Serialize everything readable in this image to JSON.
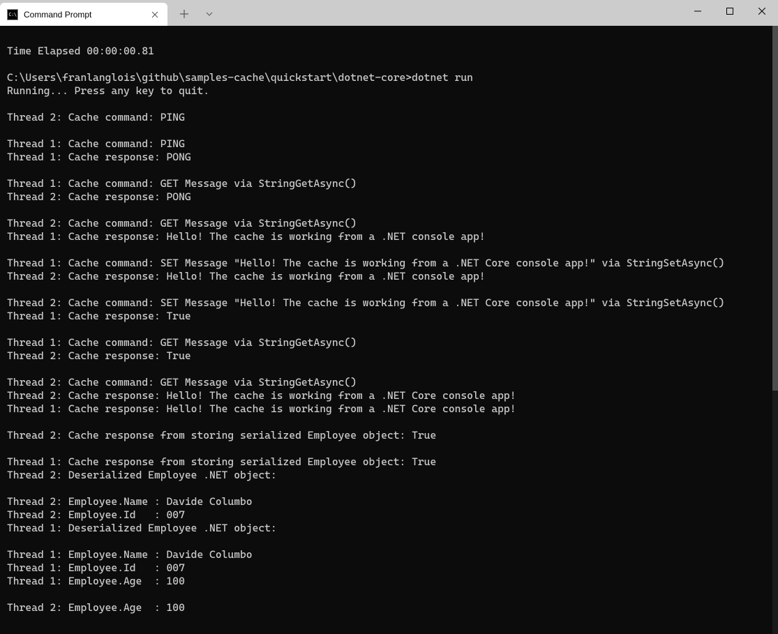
{
  "window": {
    "tab_title": "Command Prompt"
  },
  "terminal": {
    "lines": [
      "",
      "Time Elapsed 00:00:00.81",
      "",
      "C:\\Users\\franlanglois\\github\\samples-cache\\quickstart\\dotnet-core>dotnet run",
      "Running... Press any key to quit.",
      "",
      "Thread 2: Cache command: PING",
      "",
      "Thread 1: Cache command: PING",
      "Thread 1: Cache response: PONG",
      "",
      "Thread 1: Cache command: GET Message via StringGetAsync()",
      "Thread 2: Cache response: PONG",
      "",
      "Thread 2: Cache command: GET Message via StringGetAsync()",
      "Thread 1: Cache response: Hello! The cache is working from a .NET console app!",
      "",
      "Thread 1: Cache command: SET Message \"Hello! The cache is working from a .NET Core console app!\" via StringSetAsync()",
      "Thread 2: Cache response: Hello! The cache is working from a .NET console app!",
      "",
      "Thread 2: Cache command: SET Message \"Hello! The cache is working from a .NET Core console app!\" via StringSetAsync()",
      "Thread 1: Cache response: True",
      "",
      "Thread 1: Cache command: GET Message via StringGetAsync()",
      "Thread 2: Cache response: True",
      "",
      "Thread 2: Cache command: GET Message via StringGetAsync()",
      "Thread 2: Cache response: Hello! The cache is working from a .NET Core console app!",
      "Thread 1: Cache response: Hello! The cache is working from a .NET Core console app!",
      "",
      "Thread 2: Cache response from storing serialized Employee object: True",
      "",
      "Thread 1: Cache response from storing serialized Employee object: True",
      "Thread 2: Deserialized Employee .NET object:",
      "",
      "Thread 2: Employee.Name : Davide Columbo",
      "Thread 2: Employee.Id   : 007",
      "Thread 1: Deserialized Employee .NET object:",
      "",
      "Thread 1: Employee.Name : Davide Columbo",
      "Thread 1: Employee.Id   : 007",
      "Thread 1: Employee.Age  : 100",
      "",
      "Thread 2: Employee.Age  : 100",
      ""
    ]
  }
}
